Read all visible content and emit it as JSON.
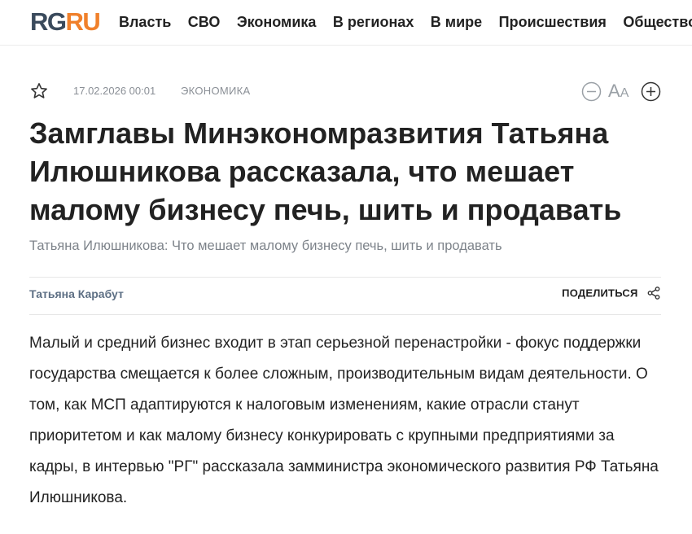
{
  "header": {
    "logo_rg": "RG",
    "logo_ru": "RU",
    "nav": [
      "Власть",
      "СВО",
      "Экономика",
      "В регионах",
      "В мире",
      "Происшествия",
      "Общество"
    ]
  },
  "article": {
    "date": "17.02.2026 00:01",
    "rubric": "ЭКОНОМИКА",
    "font_size_label": "A",
    "font_size_label_small": "A",
    "title": "Замглавы Минэкономразвития Татьяна Илюшникова рассказала, что мешает малому бизнесу печь, шить и продавать",
    "subtitle": "Татьяна Илюшникова: Что мешает малому бизнесу печь, шить и продавать",
    "author": "Татьяна Карабут",
    "share_label": "ПОДЕЛИТЬСЯ",
    "lead": "Малый и средний бизнес входит в этап серьезной перенастройки - фокус поддержки государства смещается к более сложным, производительным видам деятельности. О том, как МСП адаптируются к налоговым изменениям, какие отрасли станут приоритетом и как малому бизнесу конкурировать с крупными предприятиями за кадры, в интервью \"РГ\" рассказала замминистра экономического развития РФ Татьяна Илюшникова."
  },
  "icons": {
    "favorite": "star-outline-icon",
    "font_decrease": "minus-circle-icon",
    "font_increase": "plus-circle-icon",
    "share": "share-icon"
  },
  "colors": {
    "logo_rg": "#3a4a5c",
    "logo_ru": "#f0802b",
    "author": "#5d6f84",
    "meta": "#8a8f96"
  }
}
